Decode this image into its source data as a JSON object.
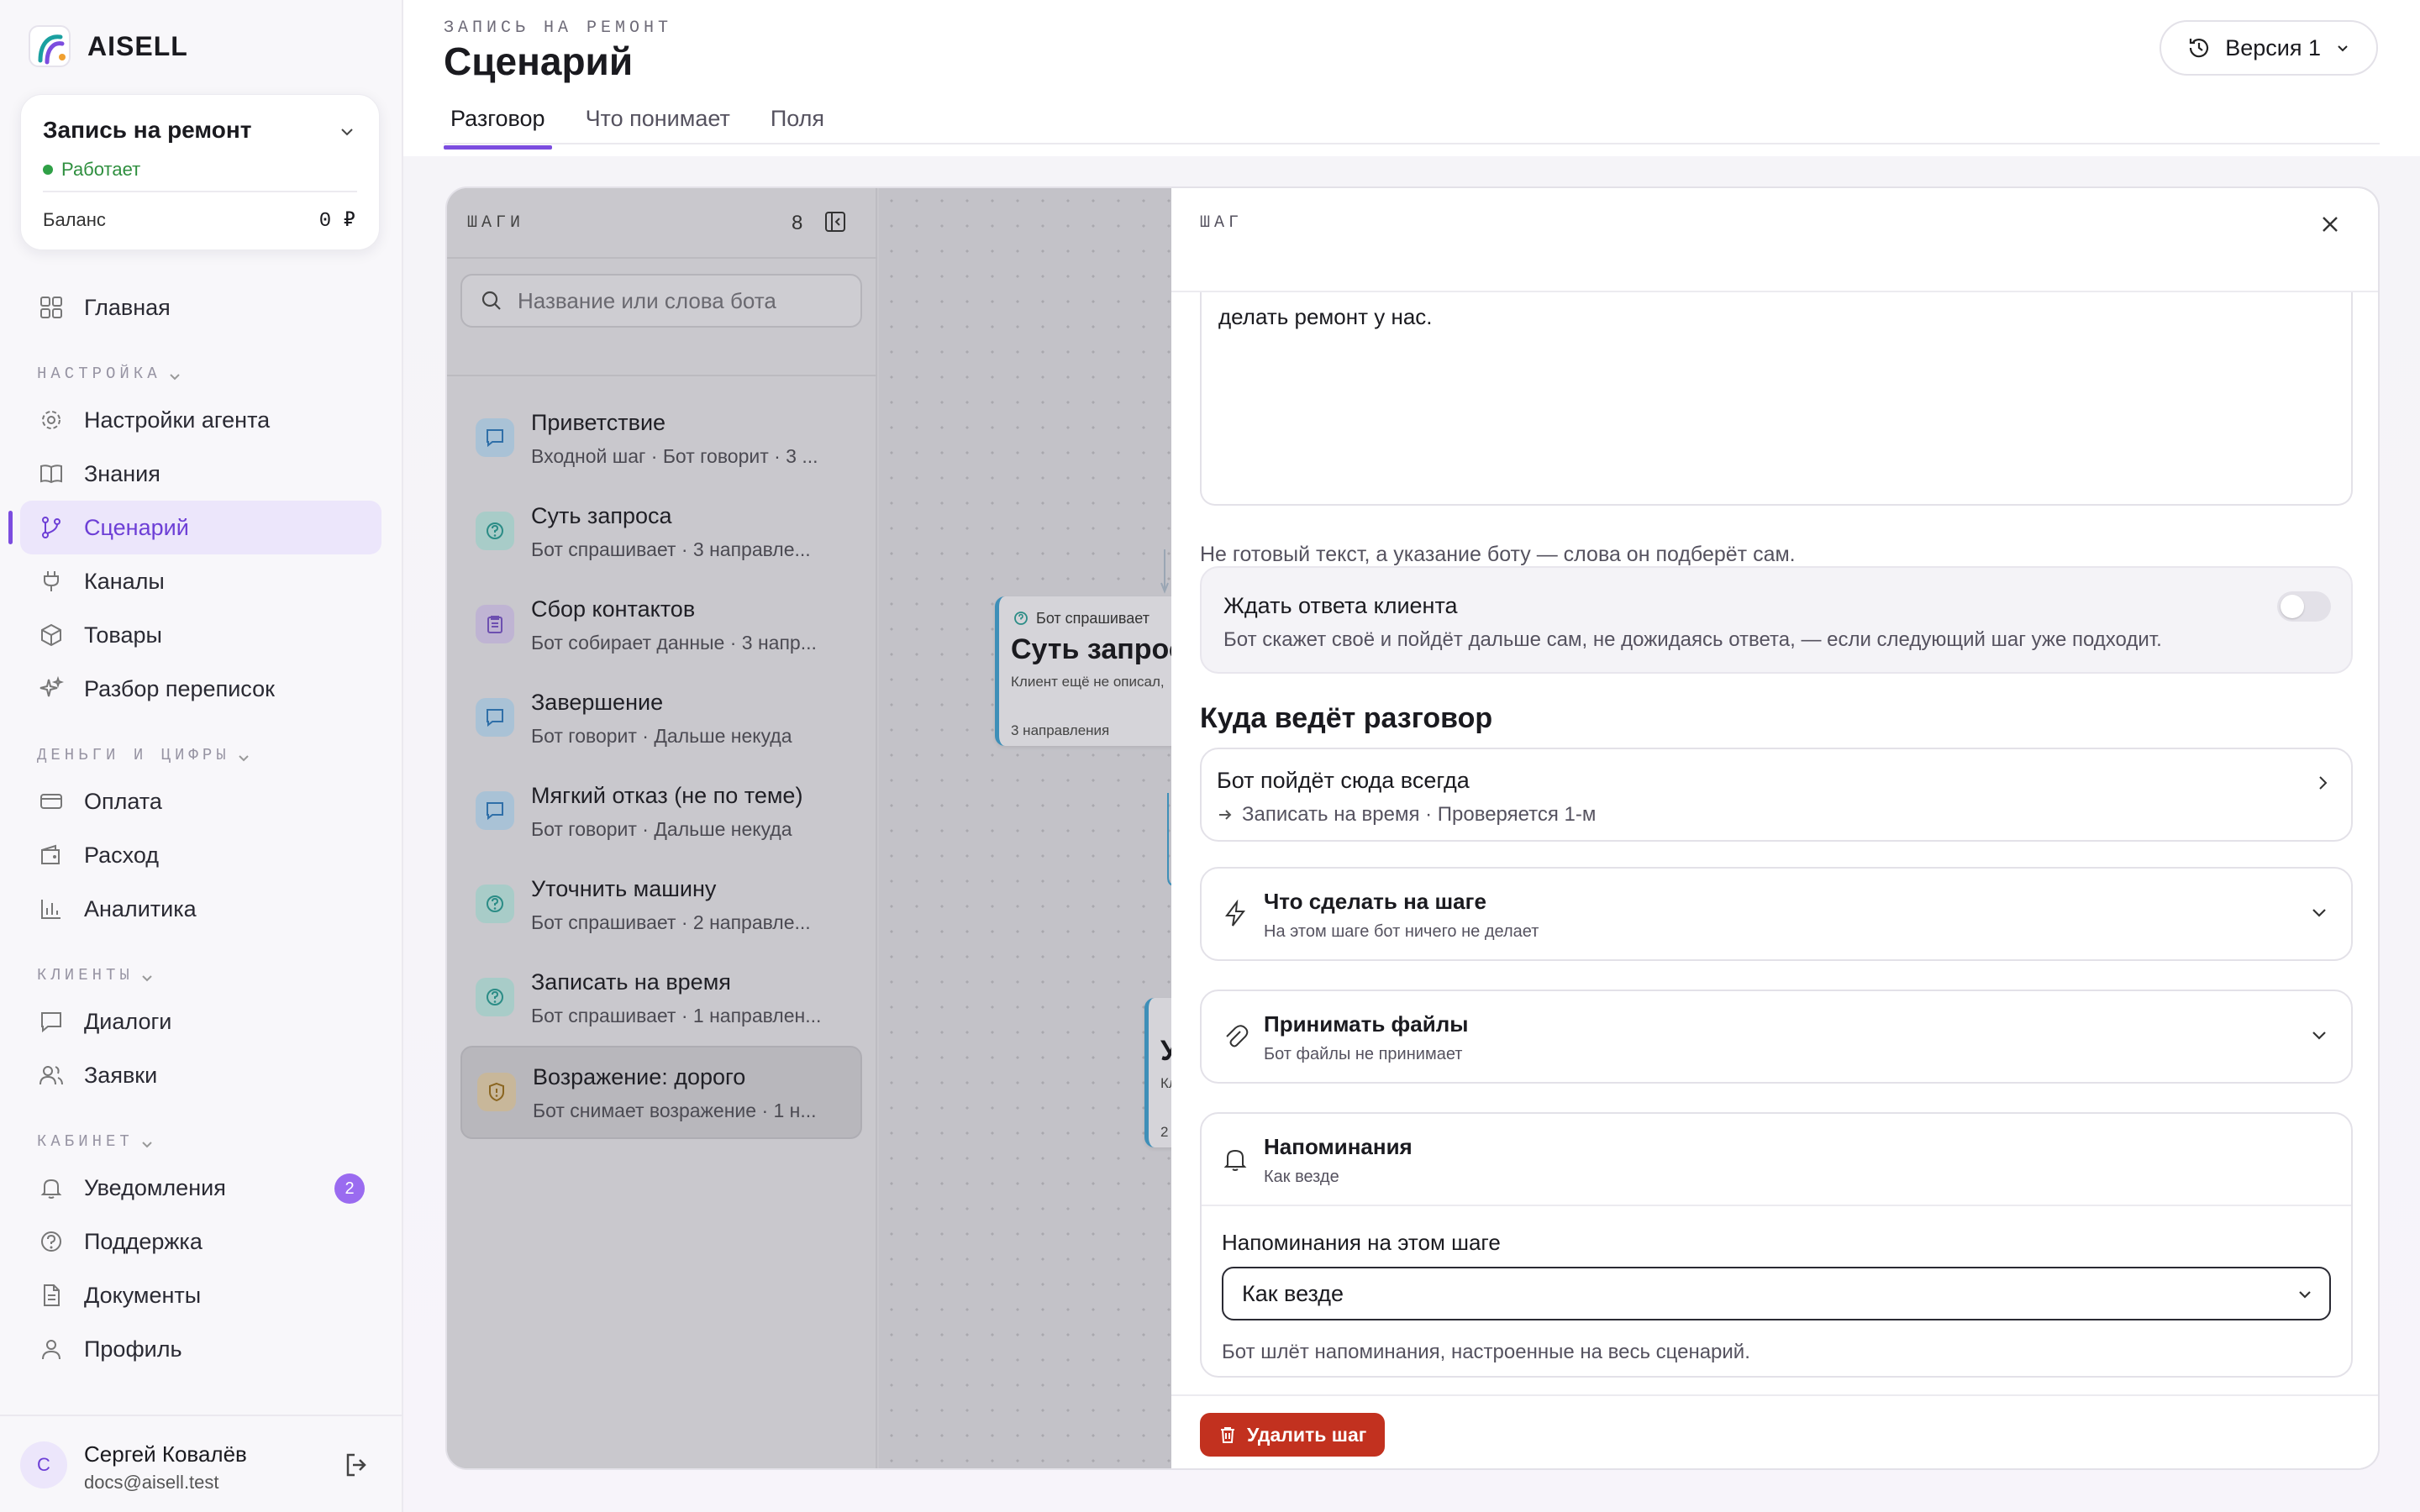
{
  "app": {
    "name": "AISELL"
  },
  "agent": {
    "name": "Запись на ремонт",
    "status": "Работает",
    "balance_label": "Баланс",
    "balance_value": "0 ₽"
  },
  "nav": {
    "main": [
      {
        "label": "Главная",
        "icon": "grid-icon"
      }
    ],
    "sections": [
      {
        "title": "НАСТРОЙКА",
        "items": [
          {
            "label": "Настройки агента",
            "icon": "gear-icon"
          },
          {
            "label": "Знания",
            "icon": "book-icon"
          },
          {
            "label": "Сценарий",
            "icon": "branch-icon",
            "active": true
          },
          {
            "label": "Каналы",
            "icon": "plug-icon"
          },
          {
            "label": "Товары",
            "icon": "box-icon"
          },
          {
            "label": "Разбор переписок",
            "icon": "sparkle-icon"
          }
        ]
      },
      {
        "title": "ДЕНЬГИ И ЦИФРЫ",
        "items": [
          {
            "label": "Оплата",
            "icon": "card-icon"
          },
          {
            "label": "Расход",
            "icon": "wallet-icon"
          },
          {
            "label": "Аналитика",
            "icon": "bar-chart-icon"
          }
        ]
      },
      {
        "title": "КЛИЕНТЫ",
        "items": [
          {
            "label": "Диалоги",
            "icon": "chat-icon"
          },
          {
            "label": "Заявки",
            "icon": "users-icon"
          }
        ]
      },
      {
        "title": "КАБИНЕТ",
        "items": [
          {
            "label": "Уведомления",
            "icon": "bell-icon",
            "badge": "2"
          },
          {
            "label": "Поддержка",
            "icon": "help-icon"
          },
          {
            "label": "Документы",
            "icon": "doc-icon"
          },
          {
            "label": "Профиль",
            "icon": "user-icon"
          }
        ]
      }
    ]
  },
  "user": {
    "initial": "С",
    "name": "Сергей Ковалёв",
    "email": "docs@aisell.test"
  },
  "header": {
    "crumb": "ЗАПИСЬ НА РЕМОНТ",
    "title": "Сценарий",
    "tabs": [
      "Разговор",
      "Что понимает",
      "Поля"
    ],
    "version": "Версия 1"
  },
  "steps": {
    "title": "ШАГИ",
    "count": "8",
    "search_placeholder": "Название или слова бота",
    "items": [
      {
        "title": "Приветствие",
        "sub": "Входной шаг · Бот говорит · 3 ...",
        "kind": "say"
      },
      {
        "title": "Суть запроса",
        "sub": "Бот спрашивает · 3 направле...",
        "kind": "ask"
      },
      {
        "title": "Сбор контактов",
        "sub": "Бот собирает данные · 3 напр...",
        "kind": "collect"
      },
      {
        "title": "Завершение",
        "sub": "Бот говорит · Дальше некуда",
        "kind": "say"
      },
      {
        "title": "Мягкий отказ (не по теме)",
        "sub": "Бот говорит · Дальше некуда",
        "kind": "say"
      },
      {
        "title": "Уточнить машину",
        "sub": "Бот спрашивает · 2 направле...",
        "kind": "ask"
      },
      {
        "title": "Записать на время",
        "sub": "Бот спрашивает · 1 направлен...",
        "kind": "ask"
      },
      {
        "title": "Возражение: дорого",
        "sub": "Бот снимает возражение · 1 н...",
        "kind": "objection",
        "selected": true
      }
    ]
  },
  "graph": {
    "node1": {
      "kind": "Бот спрашивает",
      "title": "Суть запрос",
      "desc": "Клиент ещё не описал,",
      "foot": "3 направления"
    },
    "node2": {
      "title": "У",
      "desc": "Кл",
      "foot": "2 н"
    }
  },
  "drawer": {
    "title": "ШАГ",
    "text_tail": "делать ремонт у нас.",
    "hint": "Не готовый текст, а указание боту — слова он подберёт сам.",
    "wait_label": "Ждать ответа клиента",
    "wait_sub": "Бот скажет своё и пойдёт дальше сам, не дожидаясь ответа, — если следующий шаг уже подходит.",
    "route_section": "Куда ведёт разговор",
    "route_title": "Бот пойдёт сюда всегда",
    "route_sub": "Записать на время · Проверяется 1-м",
    "action_title": "Что сделать на шаге",
    "action_sub": "На этом шаге бот ничего не делает",
    "files_title": "Принимать файлы",
    "files_sub": "Бот файлы не принимает",
    "rem_title": "Напоминания",
    "rem_sub": "Как везде",
    "rem_label": "Напоминания на этом шаге",
    "rem_value": "Как везде",
    "rem_hint": "Бот шлёт напоминания, настроенные на весь сценарий.",
    "delete_label": "Удалить шаг"
  },
  "colors": {
    "accent": "#7c4ddf",
    "danger": "#c2311f",
    "ok": "#2fa046"
  }
}
